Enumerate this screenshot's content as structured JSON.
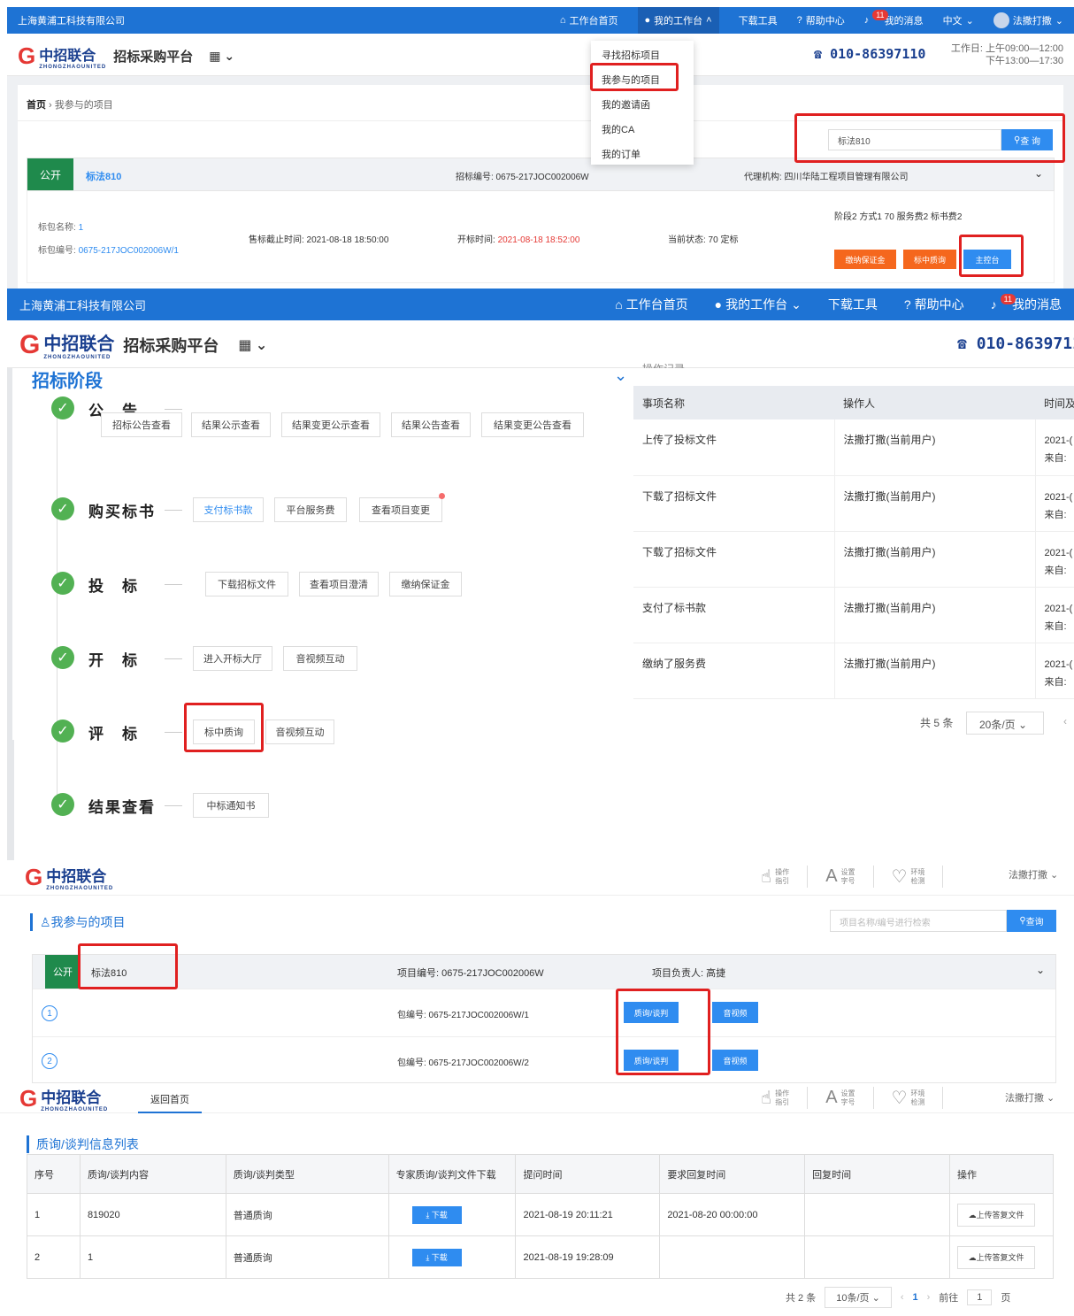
{
  "s1": {
    "company": "上海黄浦工科技有限公司",
    "nav": {
      "home": "工作台首页",
      "workbench": "我的工作台",
      "download": "下载工具",
      "help": "帮助中心",
      "msg_count": "11",
      "messages": "我的消息",
      "lang": "中文",
      "user": "法撒打撒"
    },
    "logo": {
      "cn": "中招联合",
      "en": "ZHONGZHAOUNITED",
      "platform": "招标采购平台"
    },
    "phone": "010-86397110",
    "hours": {
      "line1": "工作日: 上午09:00—12:00",
      "line2": "下午13:00—17:30"
    },
    "breadcrumb": {
      "home": "首页",
      "current": "我参与的项目"
    },
    "search_value": "标法810",
    "search_btn": "查 询",
    "menu": [
      "寻找招标项目",
      "我参与的项目",
      "我的邀请函",
      "我的CA",
      "我的订单"
    ],
    "project": {
      "tag": "公开",
      "name": "标法810",
      "code": "招标编号: 0675-217JOC002006W",
      "agency": "代理机构: 四川华陆工程项目管理有限公司",
      "pkg_name_label": "标包名称:",
      "pkg_name": "1",
      "pkg_code_label": "标包编号:",
      "pkg_code": "0675-217JOC002006W/1",
      "sale_deadline": "售标截止时间: 2021-08-18 18:50:00",
      "open_label": "开标时间:",
      "open_time": "2021-08-18 18:52:00",
      "status": "当前状态: 70 定标",
      "stage": "阶段2 方式1 70 服务费2 标书费2",
      "btn_deposit": "缴纳保证金",
      "btn_query": "标中质询",
      "btn_console": "主控台"
    }
  },
  "s2": {
    "company": "上海黄浦工科技有限公司",
    "nav": {
      "home": "工作台首页",
      "workbench": "我的工作台",
      "download": "下载工具",
      "help": "帮助中心",
      "msg_count": "11",
      "messages": "我的消息"
    },
    "logo": {
      "cn": "中招联合",
      "en": "ZHONGZHAOUNITED",
      "platform": "招标采购平台"
    },
    "phone": "010-8639711",
    "section_title": "招标阶段",
    "log_title": "操作记录",
    "stages": [
      {
        "label": "公　告",
        "buttons": [
          "招标公告查看",
          "结果公示查看",
          "结果变更公示查看",
          "结果公告查看",
          "结果变更公告查看"
        ]
      },
      {
        "label": "购买标书",
        "buttons": [
          "支付标书款",
          "平台服务费",
          "查看项目变更"
        ]
      },
      {
        "label": "投　标",
        "buttons": [
          "下载招标文件",
          "查看项目澄清",
          "缴纳保证金"
        ]
      },
      {
        "label": "开　标",
        "buttons": [
          "进入开标大厅",
          "音视频互动"
        ]
      },
      {
        "label": "评　标",
        "buttons": [
          "标中质询",
          "音视频互动"
        ]
      },
      {
        "label": "结果查看",
        "buttons": [
          "中标通知书"
        ]
      }
    ],
    "log_headers": [
      "事项名称",
      "操作人",
      "时间及"
    ],
    "log_rows": [
      {
        "item": "上传了投标文件",
        "user": "法撒打撒(当前用户)",
        "time": "2021-(",
        "from": "来自:"
      },
      {
        "item": "下载了招标文件",
        "user": "法撒打撒(当前用户)",
        "time": "2021-(",
        "from": "来自:"
      },
      {
        "item": "下载了招标文件",
        "user": "法撒打撒(当前用户)",
        "time": "2021-(",
        "from": "来自:"
      },
      {
        "item": "支付了标书款",
        "user": "法撒打撒(当前用户)",
        "time": "2021-(",
        "from": "来自:"
      },
      {
        "item": "缴纳了服务费",
        "user": "法撒打撒(当前用户)",
        "time": "2021-(",
        "from": "来自:"
      }
    ],
    "total": "共 5 条",
    "page_size": "20条/页"
  },
  "s3": {
    "logo": {
      "cn": "中招联合",
      "en": "ZHONGZHAOUNITED"
    },
    "tools": [
      {
        "big": "操作",
        "small": "指引"
      },
      {
        "big": "设置",
        "small": "字号"
      },
      {
        "big": "环境",
        "small": "检测"
      }
    ],
    "user": "法撒打撒",
    "title": "我参与的项目",
    "search_placeholder": "项目名称/编号进行检索",
    "search_btn": "查询",
    "project": {
      "tag": "公开",
      "name": "标法810",
      "code": "项目编号: 0675-217JOC002006W",
      "leader": "项目负责人: 高捷"
    },
    "packages": [
      {
        "num": "1",
        "code": "包编号: 0675-217JOC002006W/1",
        "btn1": "质询/谈判",
        "btn2": "音视频"
      },
      {
        "num": "2",
        "code": "包编号: 0675-217JOC002006W/2",
        "btn1": "质询/谈判",
        "btn2": "音视频"
      }
    ]
  },
  "s4": {
    "logo": {
      "cn": "中招联合",
      "en": "ZHONGZHAOUNITED"
    },
    "back": "返回首页",
    "tools": [
      {
        "big": "操作",
        "small": "指引"
      },
      {
        "big": "设置",
        "small": "字号"
      },
      {
        "big": "环境",
        "small": "检测"
      }
    ],
    "user": "法撒打撒",
    "title": "质询/谈判信息列表",
    "headers": [
      "序号",
      "质询/谈判内容",
      "质询/谈判类型",
      "专家质询/谈判文件下载",
      "提问时间",
      "要求回复时间",
      "回复时间",
      "操作"
    ],
    "rows": [
      {
        "no": "1",
        "content": "819020",
        "type": "普通质询",
        "dl": "下载",
        "ask": "2021-08-19 20:11:21",
        "due": "2021-08-20 00:00:00",
        "reply": "",
        "op": "上传答复文件"
      },
      {
        "no": "2",
        "content": "1",
        "type": "普通质询",
        "dl": "下载",
        "ask": "2021-08-19 19:28:09",
        "due": "",
        "reply": "",
        "op": "上传答复文件"
      }
    ],
    "pager": {
      "total": "共 2 条",
      "size": "10条/页",
      "page": "1",
      "goto": "前往",
      "goto_val": "1",
      "unit": "页"
    }
  }
}
